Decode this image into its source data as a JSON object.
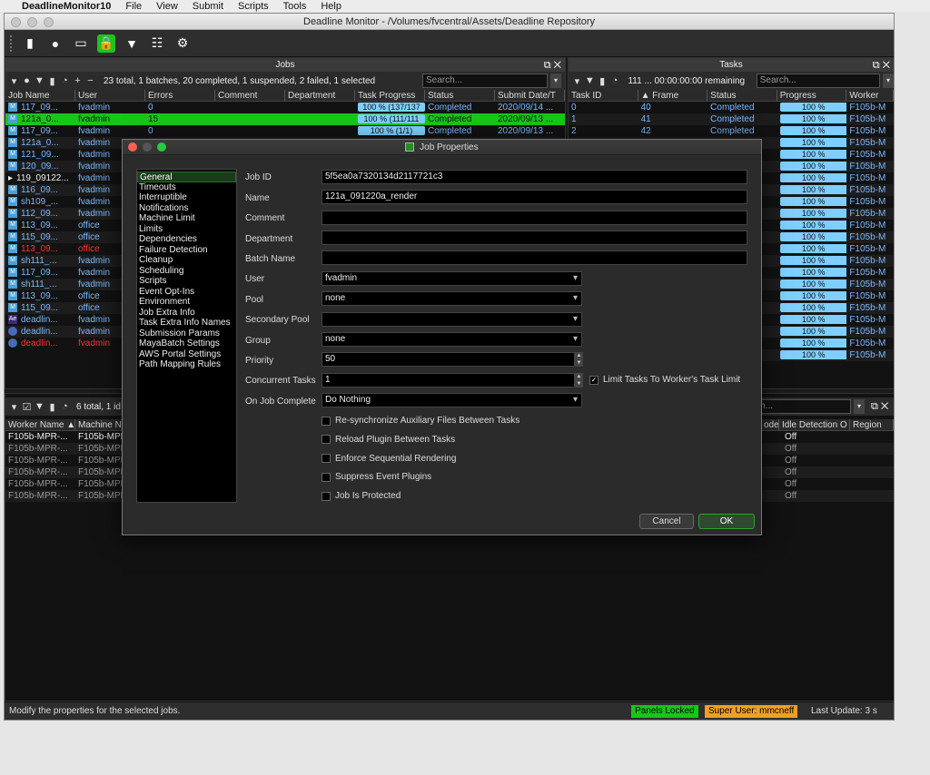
{
  "menubar": {
    "app": "DeadlineMonitor10",
    "items": [
      "File",
      "View",
      "Submit",
      "Scripts",
      "Tools",
      "Help"
    ]
  },
  "window": {
    "title": "Deadline Monitor  -  /Volumes/fvcentral/Assets/Deadline Repository"
  },
  "jobs_panel": {
    "title": "Jobs",
    "summary": "23 total, 1 batches, 20 completed, 1 suspended, 2 failed, 1 selected",
    "search_placeholder": "Search...",
    "columns": [
      "Job Name",
      "User",
      "Errors",
      "Comment",
      "Department",
      "Task Progress",
      "Status",
      "Submit Date/T"
    ],
    "rows": [
      {
        "name": "117_09...",
        "user": "fvadmin",
        "errors": "0",
        "progress": "100 %  (137/137",
        "status": "Completed",
        "date": "2020/09/14 ..."
      },
      {
        "name": "121a_0...",
        "user": "fvadmin",
        "errors": "15",
        "progress": "100 %  (111/111",
        "status": "Completed",
        "date": "2020/09/13 ..."
      },
      {
        "name": "117_09...",
        "user": "fvadmin",
        "errors": "0",
        "progress": "100 %  (1/1)",
        "status": "Completed",
        "date": "2020/09/13 ..."
      },
      {
        "name": "121a_0...",
        "user": "fvadmin"
      },
      {
        "name": "121_09...",
        "user": "fvadmin"
      },
      {
        "name": "120_09...",
        "user": "fvadmin"
      },
      {
        "name": "119_09122...",
        "user": "fvadmin"
      },
      {
        "name": "116_09...",
        "user": "fvadmin"
      },
      {
        "name": "sh109_...",
        "user": "fvadmin"
      },
      {
        "name": "112_09...",
        "user": "fvadmin"
      },
      {
        "name": "113_09...",
        "user": "office"
      },
      {
        "name": "115_09...",
        "user": "office"
      },
      {
        "name": "113_09...",
        "user": "office"
      },
      {
        "name": "sh111_...",
        "user": "fvadmin"
      },
      {
        "name": "117_09...",
        "user": "fvadmin"
      },
      {
        "name": "sh111_...",
        "user": "fvadmin"
      },
      {
        "name": "113_09...",
        "user": "office"
      },
      {
        "name": "115_09...",
        "user": "office"
      },
      {
        "name": "deadlin...",
        "user": "fvadmin"
      },
      {
        "name": "deadlin...",
        "user": "fvadmin"
      },
      {
        "name": "deadlin...",
        "user": "fvadmin"
      }
    ]
  },
  "tasks_panel": {
    "title": "Tasks",
    "summary": "111 ...  00:00:00:00 remaining",
    "search_placeholder": "Search...",
    "columns": [
      "Task ID",
      "Frame",
      "Status",
      "Progress",
      "Worker"
    ],
    "rows": [
      {
        "id": "0",
        "frame": "40",
        "status": "Completed",
        "progress": "100 %",
        "worker": "F105b-M"
      },
      {
        "id": "1",
        "frame": "41",
        "status": "Completed",
        "progress": "100 %",
        "worker": "F105b-M"
      },
      {
        "id": "2",
        "frame": "42",
        "status": "Completed",
        "progress": "100 %",
        "worker": "F105b-M"
      }
    ],
    "more_progress": "100 %",
    "more_worker": "F105b-M"
  },
  "workers_panel": {
    "summary": "6 total, 1 id",
    "search_placeholder": "Search...",
    "columns_left": [
      "Worker Name",
      "Machine Na"
    ],
    "columns_right": [
      "ode",
      "Idle Detection O",
      "Region"
    ],
    "rows": [
      {
        "worker": "F105b-MPR-...",
        "machine": "F105b-MPR",
        "idle": "Off"
      },
      {
        "worker": "F105b-MPR-...",
        "machine": "F105b-MPR",
        "idle": "Off"
      },
      {
        "worker": "F105b-MPR-...",
        "machine": "F105b-MPR",
        "idle": "Off"
      },
      {
        "worker": "F105b-MPR-...",
        "machine": "F105b-MPR",
        "idle": "Off"
      },
      {
        "worker": "F105b-MPR-...",
        "machine": "F105b-MPR",
        "idle": "Off"
      },
      {
        "worker": "F105b-MPR-...",
        "machine": "F105b-MPR",
        "idle": "Off"
      }
    ]
  },
  "statusbar": {
    "message": "Modify the properties for the selected jobs.",
    "panels_locked": "Panels Locked",
    "super_user": "Super User: mmcneff",
    "last_update": "Last Update: 3 s"
  },
  "dialog": {
    "title": "Job Properties",
    "categories": [
      "General",
      "Timeouts",
      "Interruptible",
      "Notifications",
      "Machine Limit",
      "Limits",
      "Dependencies",
      "Failure Detection",
      "Cleanup",
      "Scheduling",
      "Scripts",
      "Event Opt-Ins",
      "Environment",
      "Job Extra Info",
      "Task Extra Info Names",
      "Submission Params",
      "MayaBatch Settings",
      "AWS Portal Settings",
      "Path Mapping Rules"
    ],
    "fields": {
      "job_id_label": "Job ID",
      "job_id": "5f5ea0a7320134d2117721c3",
      "name_label": "Name",
      "name": "121a_091220a_render",
      "comment_label": "Comment",
      "comment": "",
      "department_label": "Department",
      "department": "",
      "batch_label": "Batch Name",
      "batch": "",
      "user_label": "User",
      "user": "fvadmin",
      "pool_label": "Pool",
      "pool": "none",
      "secpool_label": "Secondary Pool",
      "secpool": "",
      "group_label": "Group",
      "group": "none",
      "priority_label": "Priority",
      "priority": "50",
      "concurrent_label": "Concurrent Tasks",
      "concurrent": "1",
      "limit_label": "Limit Tasks To Worker's Task Limit",
      "oncomplete_label": "On Job Complete",
      "oncomplete": "Do Nothing"
    },
    "checkboxes": [
      "Re-synchronize Auxiliary Files Between Tasks",
      "Reload Plugin Between Tasks",
      "Enforce Sequential Rendering",
      "Suppress Event Plugins",
      "Job Is Protected"
    ],
    "cancel": "Cancel",
    "ok": "OK"
  }
}
